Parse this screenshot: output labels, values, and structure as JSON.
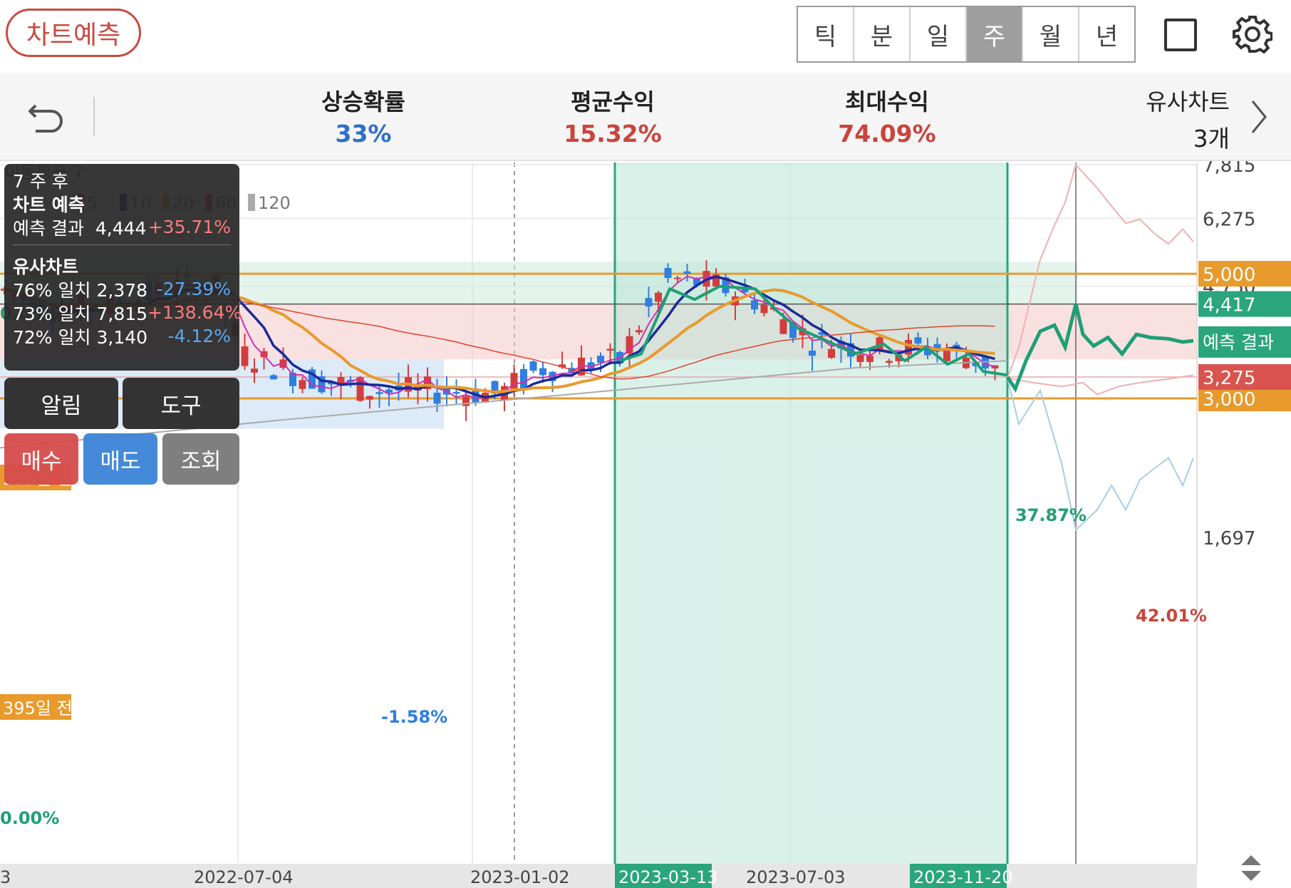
{
  "topbar": {
    "predict_button": "차트예측",
    "periods": [
      "틱",
      "분",
      "일",
      "주",
      "월",
      "년"
    ],
    "active_period": "주"
  },
  "stats": {
    "rise_prob_label": "상승확률",
    "rise_prob_value": "33%",
    "avg_return_label": "평균수익",
    "avg_return_value": "15.32%",
    "max_return_label": "최대수익",
    "max_return_value": "74.09%",
    "similar_label": "유사차트",
    "similar_count": "3개"
  },
  "info_panel": {
    "horizon": "7 주 후",
    "section1_title": "차트 예측",
    "forecast_label": "예측 결과",
    "forecast_value": "4,444",
    "forecast_change": "+35.71%",
    "section2_title": "유사차트",
    "matches": [
      {
        "label": "76% 일치",
        "value": "2,378",
        "change": "-27.39%"
      },
      {
        "label": "73% 일치",
        "value": "7,815",
        "change": "+138.64%"
      },
      {
        "label": "72% 일치",
        "value": "3,140",
        "change": "-4.12%"
      }
    ]
  },
  "buttons": {
    "alert": "알림",
    "tools": "도구",
    "buy": "매수",
    "sell": "매도",
    "inquiry": "조회"
  },
  "chart_data": {
    "type": "candlestick",
    "interval": "weekly",
    "y_ticks": [
      "7,815",
      "6,275",
      "4,750",
      "1,697"
    ],
    "y_range": [
      1697,
      7815
    ],
    "x_ticks": [
      "3",
      "2022-07-04",
      "2023-01-02",
      "2023-03-13",
      "2023-07-03",
      "2023-11-20"
    ],
    "highlighted_dates": [
      "2023-03-13",
      "2023-11-20"
    ],
    "horizontal_levels": [
      {
        "label": "5,000",
        "value": 5000,
        "color": "#e89a2c"
      },
      {
        "label": "3,000",
        "value": 3000,
        "color": "#e89a2c"
      },
      {
        "label": "4,417",
        "value": 4417,
        "color": "#2aa57c"
      },
      {
        "label": "3,275",
        "value": 3275,
        "color": "#d9534f"
      }
    ],
    "forecast_tag": "예측 결과",
    "ma_legend_title": "이동평균 7",
    "ma_legend_periods": [
      "5",
      "10",
      "20",
      "60",
      "120"
    ],
    "zone_tags": [
      "395일 전",
      "395일 전"
    ],
    "annotations": [
      "0.00%",
      "0.00%",
      "4.55%",
      "-1.58%",
      "37.87%",
      "42.01%",
      "0.00%"
    ],
    "forecast_path": [
      3275,
      3120,
      3500,
      3950,
      4050,
      3700,
      4417,
      3900,
      3720,
      3850,
      3600,
      3900,
      3850,
      3830,
      3780,
      3800
    ],
    "similar_paths": [
      {
        "name": "76% 일치",
        "color": "#f0b0b0"
      },
      {
        "name": "73% 일치",
        "color": "#a9cde8"
      },
      {
        "name": "72% 일치",
        "color": "#f0b0b0"
      }
    ]
  }
}
